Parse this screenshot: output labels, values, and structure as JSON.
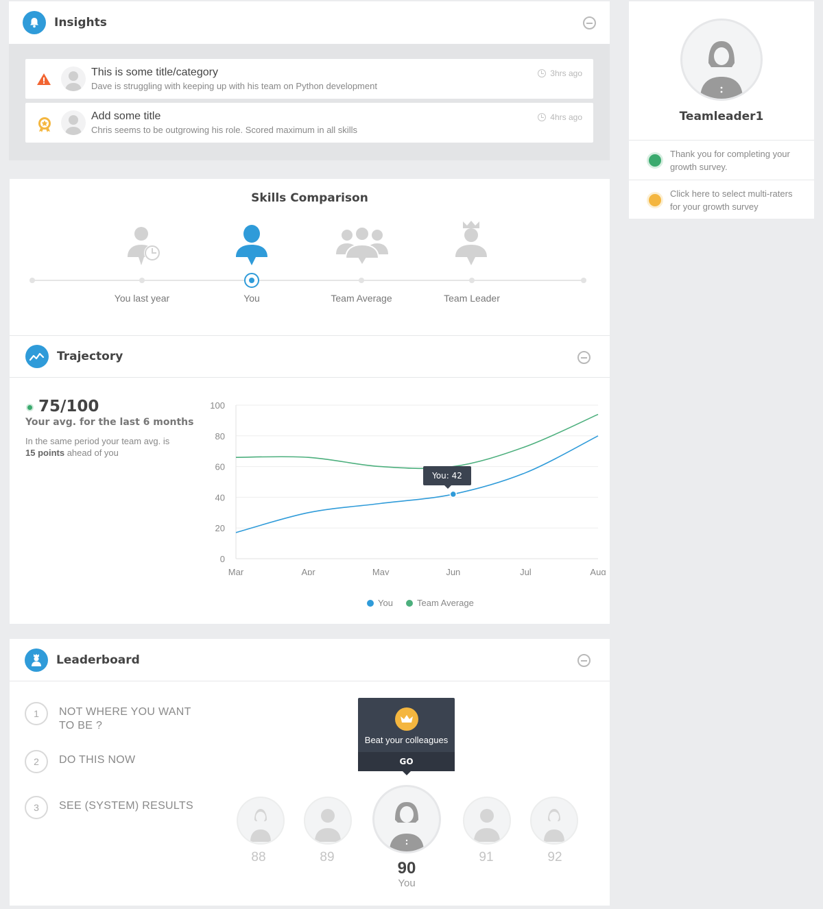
{
  "insights": {
    "title": "Insights",
    "items": [
      {
        "icon": "warning-icon",
        "title": "This is some title/category",
        "desc": "Dave is struggling with keeping up with his team on Python development",
        "time": "3hrs ago"
      },
      {
        "icon": "award-icon",
        "title": "Add some title",
        "desc": "Chris seems to be outgrowing his role. Scored maximum in all skills",
        "time": "4hrs ago"
      }
    ]
  },
  "skills": {
    "title": "Skills Comparison",
    "items": [
      "You last year",
      "You",
      "Team Average",
      "Team Leader"
    ],
    "selected": "You"
  },
  "trajectory": {
    "title": "Trajectory",
    "score": "75/100",
    "avg_label": "Your avg. for the last 6 months",
    "desc_prefix": "In the same period your team avg. is",
    "desc_bold": "15 points",
    "desc_suffix": "ahead of you",
    "tooltip": "You: 42"
  },
  "chart_data": {
    "type": "line",
    "x": [
      "Mar",
      "Apr",
      "May",
      "Jun",
      "Jul",
      "Aug"
    ],
    "series": [
      {
        "name": "You",
        "color": "#2f9bd9",
        "values": [
          17,
          30,
          36,
          42,
          56,
          80
        ]
      },
      {
        "name": "Team Average",
        "color": "#4caf7d",
        "values": [
          66,
          66,
          60,
          60,
          73,
          94
        ]
      }
    ],
    "ylim": [
      0,
      100
    ],
    "yticks": [
      0,
      20,
      40,
      60,
      80,
      100
    ],
    "grid": true,
    "legend": "bottom",
    "highlight": {
      "series": "You",
      "x": "Jun",
      "value": 42
    }
  },
  "leaderboard": {
    "title": "Leaderboard",
    "steps": [
      {
        "num": "1",
        "text": "NOT WHERE YOU WANT TO BE ?"
      },
      {
        "num": "2",
        "text": "DO THIS NOW"
      },
      {
        "num": "3",
        "text": "SEE (SYSTEM) RESULTS"
      }
    ],
    "popup": {
      "text": "Beat your colleagues",
      "button": "GO"
    },
    "ranks": [
      "88",
      "89",
      "90",
      "91",
      "92"
    ],
    "you_label": "You"
  },
  "profile": {
    "name": "Teamleader1",
    "items": [
      {
        "color": "#3aaa6e",
        "text": "Thank you for completing your growth survey."
      },
      {
        "color": "#f4b63f",
        "text": "Click here to select multi-raters for your growth survey"
      }
    ]
  }
}
